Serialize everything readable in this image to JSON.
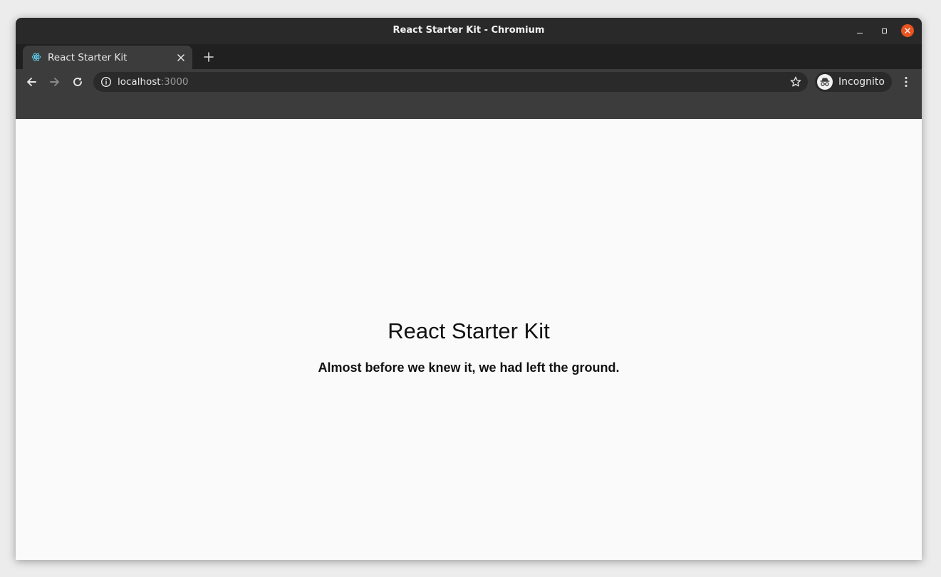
{
  "window": {
    "title": "React Starter Kit - Chromium"
  },
  "tabs": [
    {
      "title": "React Starter Kit",
      "favicon": "react-logo-icon",
      "active": true
    }
  ],
  "toolbar": {
    "url_host": "localhost",
    "url_port": ":3000",
    "profile_label": "Incognito"
  },
  "page": {
    "heading": "React Starter Kit",
    "subheading": "Almost before we knew it, we had left the ground."
  },
  "colors": {
    "titlebar": "#292929",
    "toolbar": "#3c3c3c",
    "close_button": "#e95420",
    "page_background": "#fafafa",
    "react_logo": "#61dafb"
  }
}
